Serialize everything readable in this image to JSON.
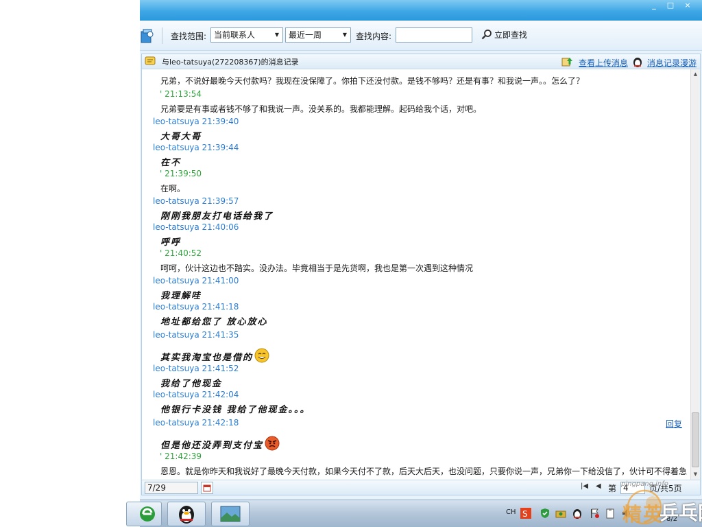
{
  "window": {
    "controls": [
      "_",
      "□",
      "×"
    ]
  },
  "toolbar": {
    "scope_label": "查找范围:",
    "scope_value": "当前联系人",
    "period_value": "最近一周",
    "content_label": "查找内容:",
    "search_value": "",
    "find_button": "立即查找"
  },
  "panel": {
    "title": "与leo-tatsuya(272208367)的消息记录",
    "view_uploads_link": "查看上传消息",
    "roaming_link": "消息记录漫游",
    "reply_link": "回复"
  },
  "messages": [
    {
      "sender": "",
      "time": "",
      "text": "兄弟，不说好最晚今天付款吗？我现在没保障了。你拍下还没付款。是钱不够吗？还是有事？和我说一声。。怎么了？"
    },
    {
      "sender": "'",
      "time": "21:13:54",
      "text": "兄弟要是有事或者钱不够了和我说一声。没关系的。我都能理解。起码给我个话，对吧。"
    },
    {
      "sender": "leo-tatsuya",
      "time": "21:39:40",
      "text": "大哥大哥"
    },
    {
      "sender": "leo-tatsuya",
      "time": "21:39:44",
      "text": "在不"
    },
    {
      "sender": "'",
      "time": "21:39:50",
      "text": "在啊。"
    },
    {
      "sender": "leo-tatsuya",
      "time": "21:39:57",
      "text": "刚刚我朋友打电话给我了"
    },
    {
      "sender": "leo-tatsuya",
      "time": "21:40:06",
      "text": "呼呼"
    },
    {
      "sender": "'",
      "time": "21:40:52",
      "text": "呵呵，伙计这边也不踏实。没办法。毕竟相当于是先货啊，我也是第一次遇到这种情况"
    },
    {
      "sender": "leo-tatsuya",
      "time": "21:41:00",
      "text": "我理解哇"
    },
    {
      "sender": "leo-tatsuya",
      "time": "21:41:18",
      "text": "地址都给您了 放心放心"
    },
    {
      "sender": "leo-tatsuya",
      "time": "21:41:35",
      "text": "其实我淘宝也是借的"
    },
    {
      "sender": "leo-tatsuya",
      "time": "21:41:52",
      "text": "我给了他现金"
    },
    {
      "sender": "leo-tatsuya",
      "time": "21:42:04",
      "text": "他银行卡没钱 我给了他现金。。。"
    },
    {
      "sender": "leo-tatsuya",
      "time": "21:42:18",
      "text": "但是他还没弄到支付宝"
    },
    {
      "sender": "'",
      "time": "21:42:39",
      "text": "恩恩。就是你昨天和我说好了最晚今天付款，如果今天付不了款，后天大后天，也没问题，只要你说一声，兄弟你一下给没信了，伙计可不得着急"
    }
  ],
  "footer": {
    "date": "7/29",
    "page_label": "第",
    "page_value": "4",
    "page_total": "页/共5页"
  },
  "taskbar": {
    "lang": "CH",
    "clock": "8/2"
  },
  "watermark": {
    "site": "pingpang.info",
    "brand_a": "精英",
    "brand_b": "乒乓网"
  },
  "colors": {
    "titlebar": "#3ea7e6",
    "peer_header": "#2a7cd3",
    "self_header": "#2fa33b",
    "link": "#1a5fb4"
  }
}
